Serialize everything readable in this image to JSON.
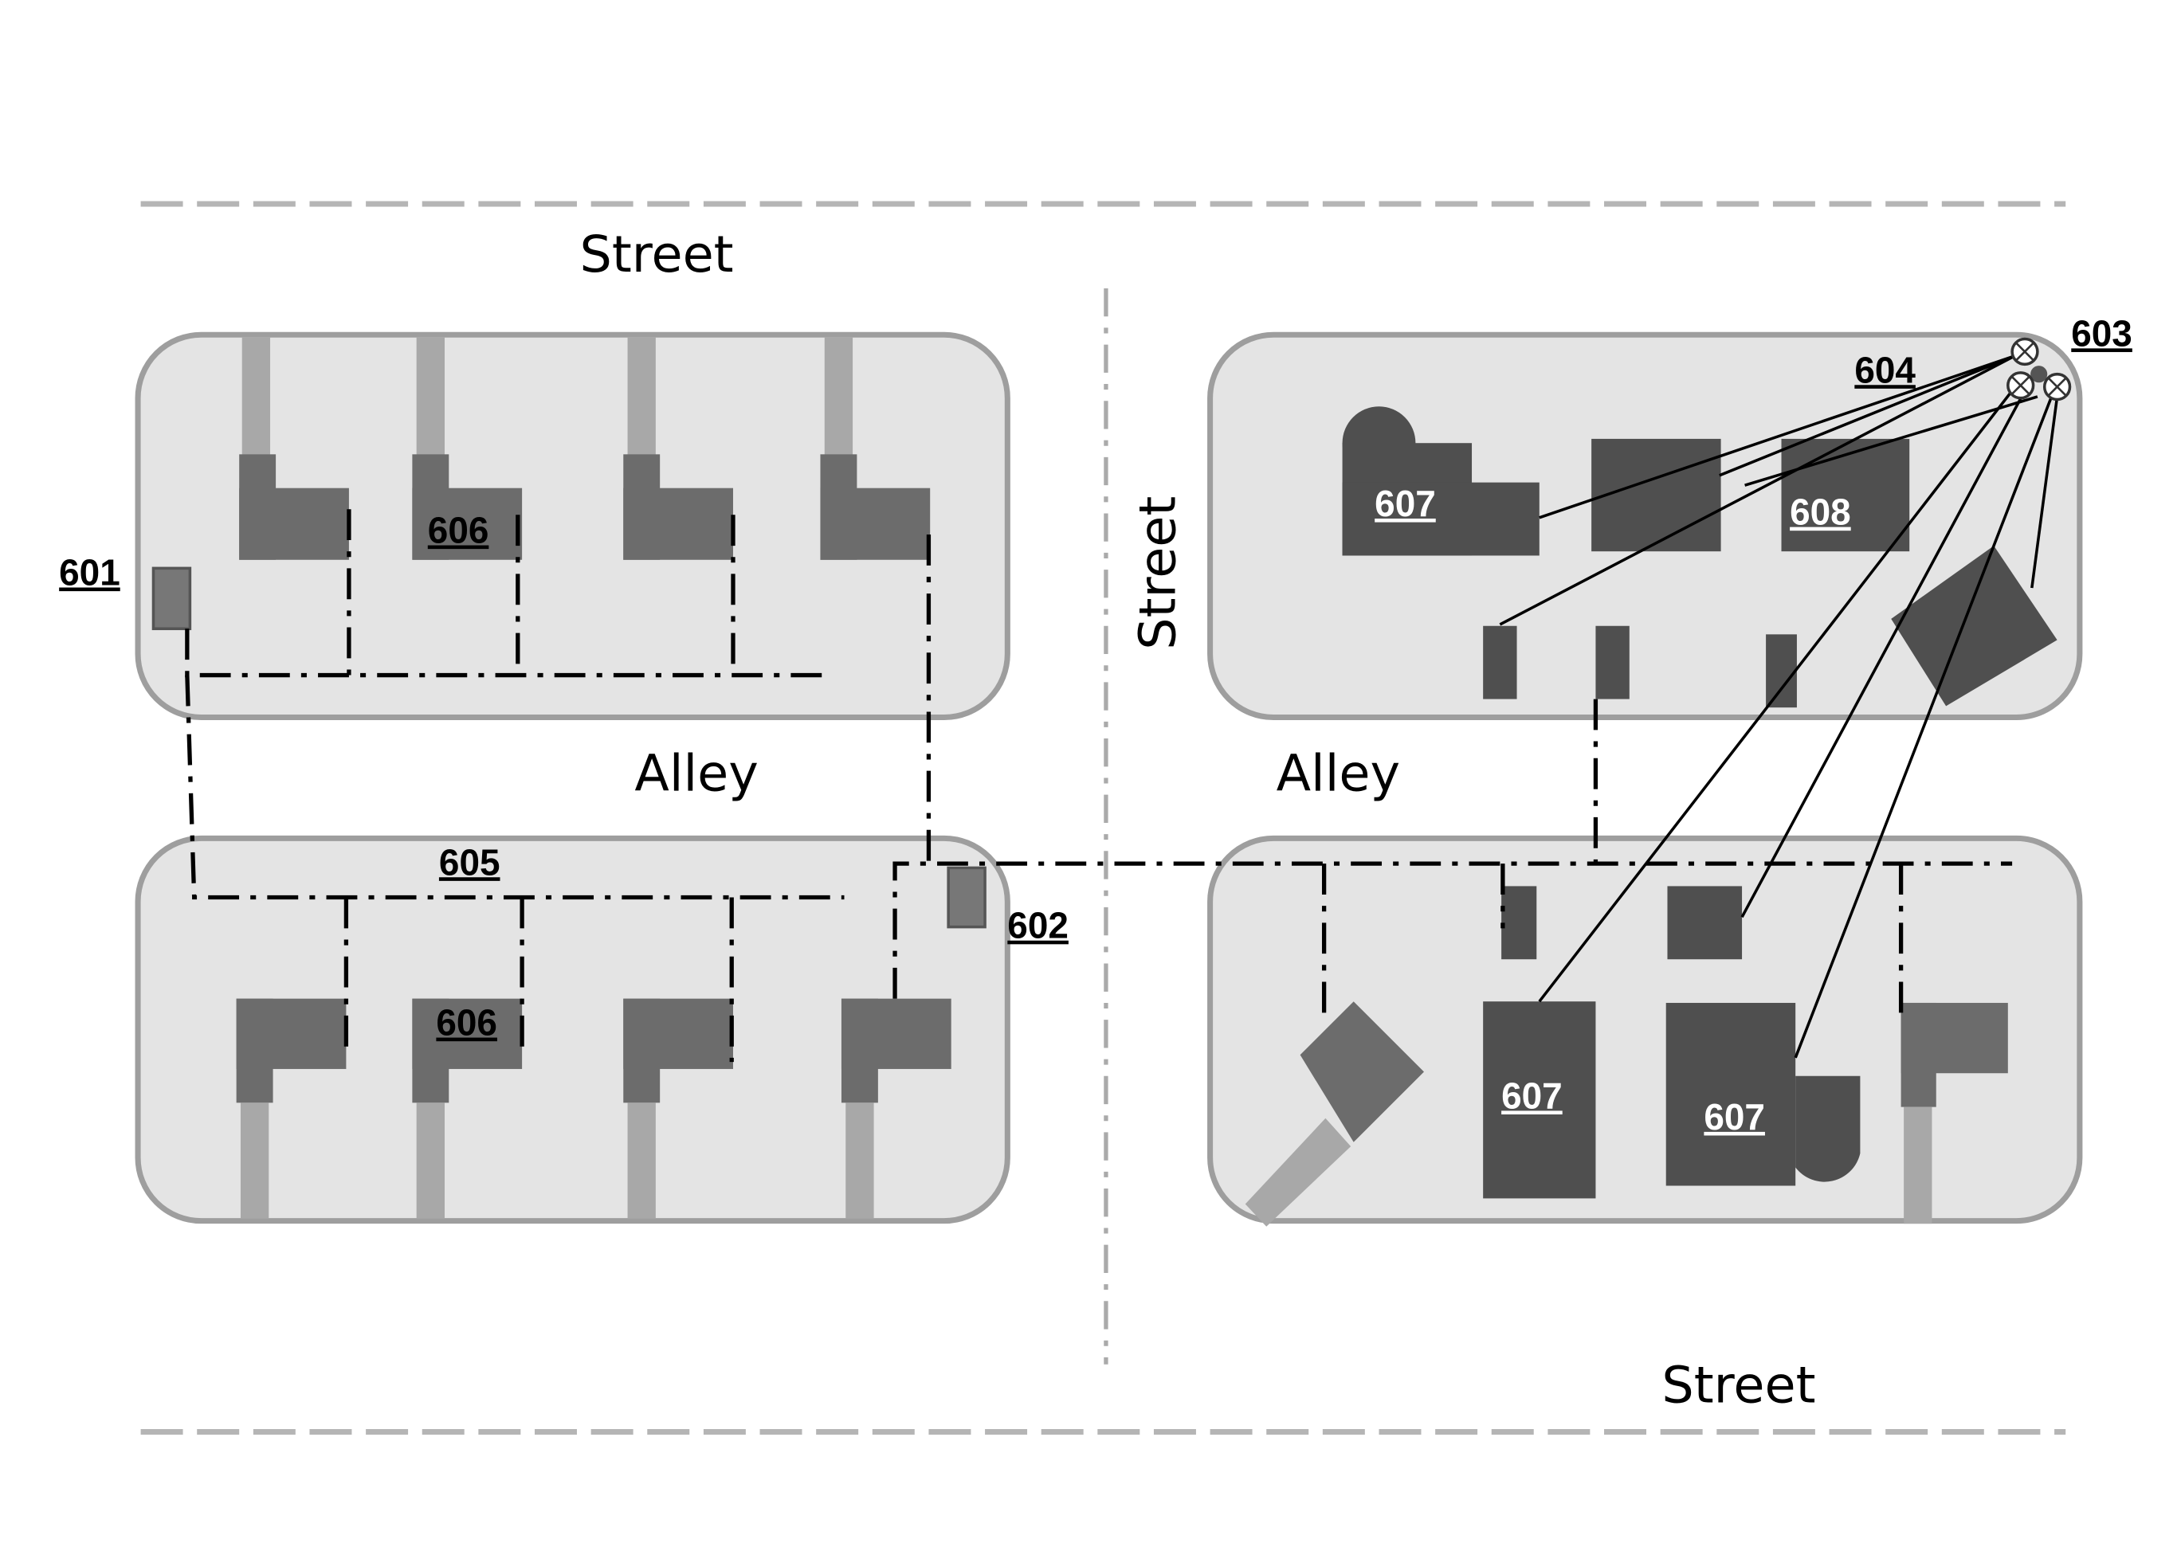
{
  "labels": {
    "street_top": "Street",
    "street_middle": "Street",
    "street_bottom": "Street",
    "alley_left": "Alley",
    "alley_right": "Alley"
  },
  "refs": {
    "r601": "601",
    "r602": "602",
    "r603": "603",
    "r604": "604",
    "r605": "605",
    "r606_top": "606",
    "r606_bottom": "606",
    "r607_top": "607",
    "r607_bottom_a": "607",
    "r607_bottom_b": "607",
    "r608": "608"
  },
  "components": [
    {
      "ref": "601",
      "kind": "utility box"
    },
    {
      "ref": "602",
      "kind": "utility box"
    },
    {
      "ref": "603",
      "kind": "wireless node cluster"
    },
    {
      "ref": "604",
      "kind": "wireless links"
    },
    {
      "ref": "605",
      "kind": "wired network path"
    },
    {
      "ref": "606",
      "kind": "wired residence"
    },
    {
      "ref": "607",
      "kind": "wireless residence"
    },
    {
      "ref": "608",
      "kind": "wireless building"
    }
  ]
}
